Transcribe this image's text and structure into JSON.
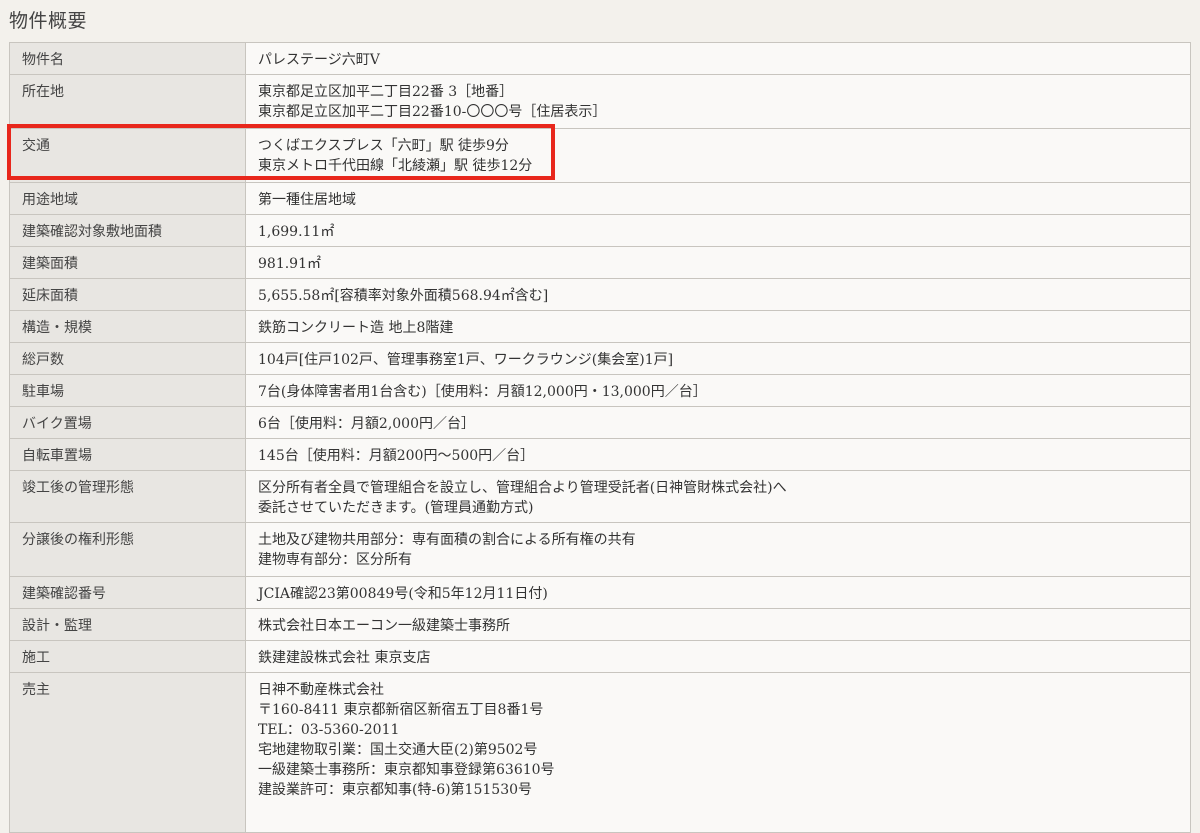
{
  "page": {
    "title": "物件概要"
  },
  "rows": [
    {
      "label": "物件名",
      "lines": [
        "パレステージ六町V"
      ]
    },
    {
      "label": "所在地",
      "lines": [
        "東京都足立区加平二丁目22番 3［地番］",
        "東京都足立区加平二丁目22番10-〇〇〇号［住居表示］"
      ]
    },
    {
      "label": "交通",
      "lines": [
        "つくばエクスプレス「六町」駅 徒歩9分",
        "東京メトロ千代田線「北綾瀬」駅 徒歩12分"
      ]
    },
    {
      "label": "用途地域",
      "lines": [
        "第一種住居地域"
      ]
    },
    {
      "label": "建築確認対象敷地面積",
      "lines": [
        "1,699.11㎡"
      ]
    },
    {
      "label": "建築面積",
      "lines": [
        "981.91㎡"
      ]
    },
    {
      "label": "延床面積",
      "lines": [
        "5,655.58㎡[容積率対象外面積568.94㎡含む]"
      ]
    },
    {
      "label": "構造・規模",
      "lines": [
        "鉄筋コンクリート造 地上8階建"
      ]
    },
    {
      "label": "総戸数",
      "lines": [
        "104戸[住戸102戸、管理事務室1戸、ワークラウンジ(集会室)1戸]"
      ]
    },
    {
      "label": "駐車場",
      "lines": [
        "7台(身体障害者用1台含む)［使用料：月額12,000円・13,000円／台］"
      ]
    },
    {
      "label": "バイク置場",
      "lines": [
        "6台［使用料：月額2,000円／台］"
      ]
    },
    {
      "label": "自転車置場",
      "lines": [
        "145台［使用料：月額200円〜500円／台］"
      ]
    },
    {
      "label": "竣工後の管理形態",
      "lines": [
        "区分所有者全員で管理組合を設立し、管理組合より管理受託者(日神管財株式会社)へ",
        "委託させていただきます。(管理員通勤方式)"
      ]
    },
    {
      "label": "分譲後の権利形態",
      "lines": [
        "土地及び建物共用部分：専有面積の割合による所有権の共有",
        "建物専有部分：区分所有"
      ]
    },
    {
      "label": "建築確認番号",
      "lines": [
        "JCIA確認23第00849号(令和5年12月11日付)"
      ]
    },
    {
      "label": "設計・監理",
      "lines": [
        "株式会社日本エーコン一級建築士事務所"
      ]
    },
    {
      "label": "施工",
      "lines": [
        "鉄建建設株式会社 東京支店"
      ]
    },
    {
      "label": "売主",
      "lines": [
        "日神不動産株式会社",
        "〒160-8411 東京都新宿区新宿五丁目8番1号",
        "TEL：03-5360-2011",
        "宅地建物取引業：国土交通大臣(2)第9502号",
        "一級建築士事務所：東京都知事登録第63610号",
        "建設業許可：東京都知事(特-6)第151530号"
      ]
    }
  ],
  "colors": {
    "highlight": "#e8271c",
    "label_bg": "#e8e6e2",
    "value_bg": "#faf9f7",
    "page_bg": "#f3f1ec"
  }
}
